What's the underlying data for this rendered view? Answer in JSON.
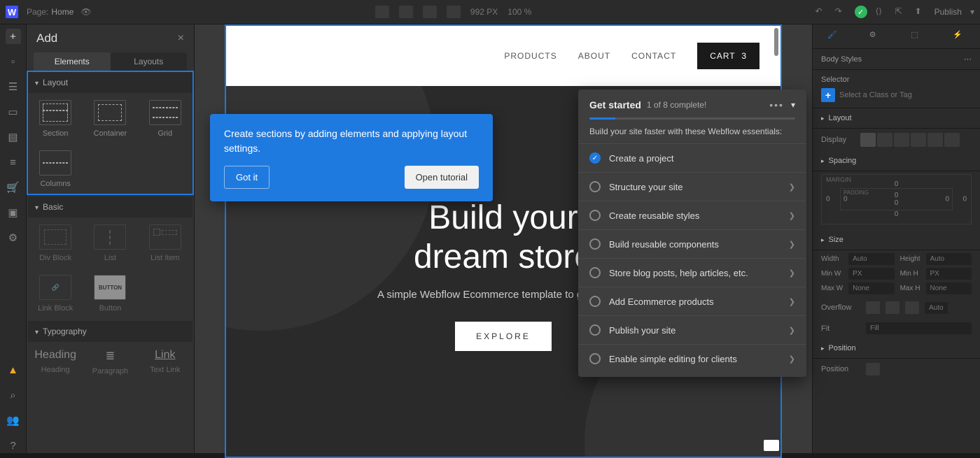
{
  "topbar": {
    "page_prefix": "Page:",
    "page_name": "Home",
    "width_px": "992 PX",
    "zoom": "100 %",
    "publish": "Publish"
  },
  "addpanel": {
    "title": "Add",
    "tabs": {
      "elements": "Elements",
      "layouts": "Layouts"
    },
    "groups": {
      "layout": {
        "label": "Layout",
        "items": {
          "section": "Section",
          "container": "Container",
          "grid": "Grid",
          "columns": "Columns"
        }
      },
      "basic": {
        "label": "Basic",
        "items": {
          "div": "Div Block",
          "list": "List",
          "listitem": "List Item",
          "linkblock": "Link Block",
          "button": "Button"
        },
        "button_glyph": "BUTTON"
      },
      "typography": {
        "label": "Typography",
        "heading_sample": "Heading",
        "link_sample": "Link",
        "items": {
          "heading": "Heading",
          "paragraph": "Paragraph",
          "textlink": "Text Link"
        }
      }
    }
  },
  "tooltip": {
    "text": "Create sections by adding elements and applying layout settings.",
    "got_it": "Got it",
    "open_tutorial": "Open tutorial"
  },
  "site": {
    "nav": {
      "products": "PRODUCTS",
      "about": "ABOUT",
      "contact": "CONTACT",
      "cart": "CART",
      "cart_count": "3"
    },
    "hero": {
      "title_line1": "Build your",
      "title_line2": "dream store",
      "subtitle": "A simple Webflow Ecommerce template to get started.",
      "cta": "EXPLORE"
    }
  },
  "getstarted": {
    "title": "Get started",
    "progress": "1 of 8 complete!",
    "subtitle": "Build your site faster with these Webflow essentials:",
    "items": [
      {
        "label": "Create a project",
        "done": true
      },
      {
        "label": "Structure your site",
        "done": false
      },
      {
        "label": "Create reusable styles",
        "done": false
      },
      {
        "label": "Build reusable components",
        "done": false
      },
      {
        "label": "Store blog posts, help articles, etc.",
        "done": false
      },
      {
        "label": "Add Ecommerce products",
        "done": false
      },
      {
        "label": "Publish your site",
        "done": false
      },
      {
        "label": "Enable simple editing for clients",
        "done": false
      }
    ]
  },
  "rightpanel": {
    "body_styles": "Body Styles",
    "selector_label": "Selector",
    "selector_placeholder": "Select a Class or Tag",
    "layout_label": "Layout",
    "display_label": "Display",
    "spacing_label": "Spacing",
    "margin_label": "MARGIN",
    "padding_label": "PADDING",
    "size_label": "Size",
    "size": {
      "width": "Width",
      "width_v": "Auto",
      "height": "Height",
      "height_v": "Auto",
      "minw": "Min W",
      "minw_v": "PX",
      "minh": "Min H",
      "minh_v": "PX",
      "maxw": "Max W",
      "maxw_v": "None",
      "maxh": "Max H",
      "maxh_v": "None"
    },
    "overflow": "Overflow",
    "overflow_auto": "Auto",
    "fit": "Fit",
    "fit_v": "Fill",
    "position_label": "Position",
    "position": "Position"
  }
}
